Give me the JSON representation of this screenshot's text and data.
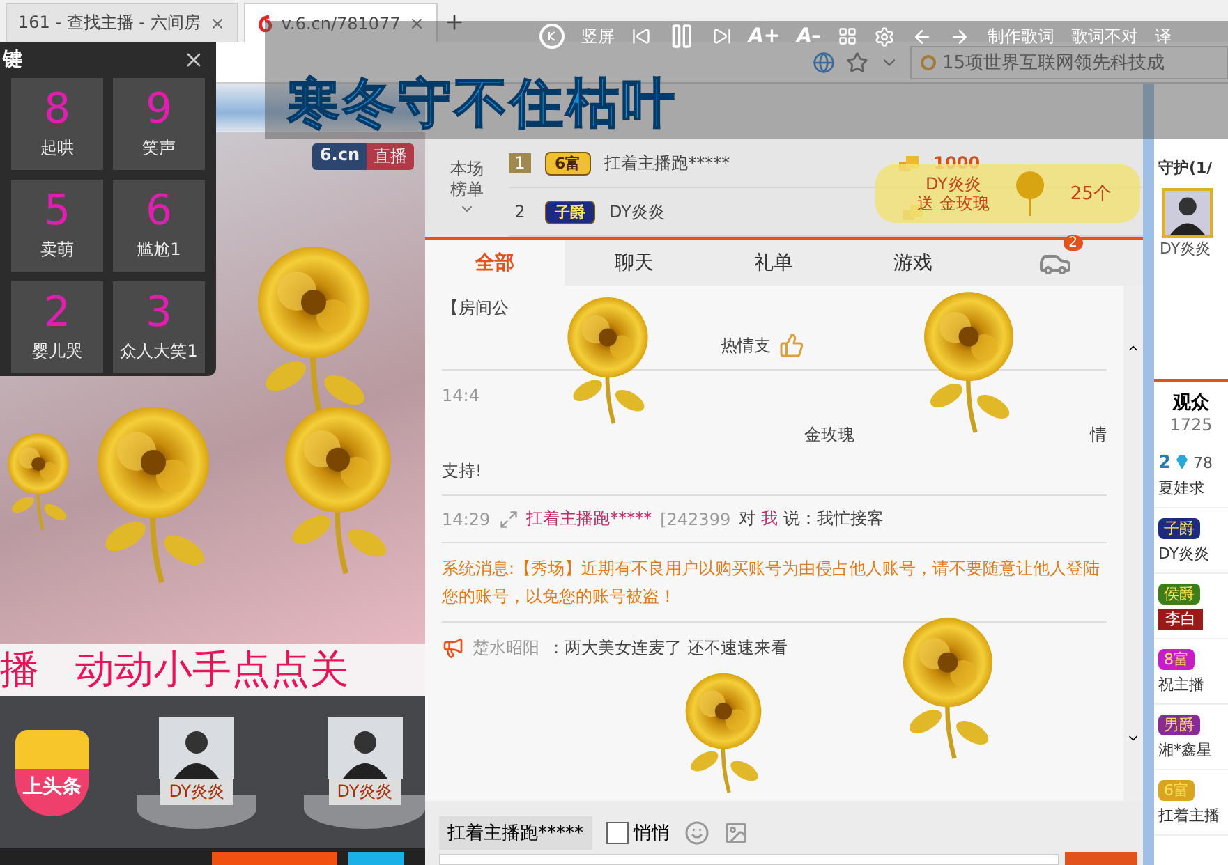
{
  "browser": {
    "tabs": [
      {
        "title": "161 - 查找主播 - 六间房",
        "selected": false
      },
      {
        "title": "v.6.cn/781077",
        "selected": true
      }
    ],
    "search_text": "15项世界互联网领先科技成"
  },
  "lyrics_window": {
    "toolbar": [
      {
        "kind": "logo"
      },
      {
        "kind": "text",
        "label": "竖屏"
      },
      {
        "kind": "prev"
      },
      {
        "kind": "pause"
      },
      {
        "kind": "next"
      },
      {
        "kind": "font",
        "label": "A+"
      },
      {
        "kind": "font",
        "label": "A–"
      },
      {
        "kind": "grid"
      },
      {
        "kind": "gear"
      },
      {
        "kind": "left"
      },
      {
        "kind": "right"
      },
      {
        "kind": "text",
        "label": "制作歌词"
      },
      {
        "kind": "text",
        "label": "歌词不对"
      },
      {
        "kind": "text",
        "label": "译"
      }
    ],
    "lyric": "寒冬守不住枯叶"
  },
  "sound_keys": {
    "title": "键",
    "keys": [
      {
        "key": "8",
        "label": "起哄"
      },
      {
        "key": "9",
        "label": "笑声"
      },
      {
        "key": "5",
        "label": "卖萌"
      },
      {
        "key": "6",
        "label": "尴尬1"
      },
      {
        "key": "2",
        "label": "婴儿哭"
      },
      {
        "key": "3",
        "label": "众人大笑1"
      }
    ]
  },
  "video": {
    "brand": "6.cn",
    "live": "直播",
    "ticker": [
      "播",
      "动动小手点点关"
    ]
  },
  "headline": {
    "label": "上头条"
  },
  "pedestals": [
    {
      "name": "DY炎炎"
    },
    {
      "name": "DY炎炎"
    }
  ],
  "ranking": {
    "title": "本场榜单",
    "rows": [
      {
        "rank": "1",
        "kind": "fortune",
        "badge": "6富",
        "name": "扛着主播跑*****",
        "score": "1000"
      },
      {
        "rank": "2",
        "kind": "noble",
        "badge": "子爵",
        "name": "DY炎炎"
      }
    ]
  },
  "gift_notice": {
    "sender": "DY炎炎",
    "action": "送 金玫瑰",
    "count": "25个"
  },
  "chat_tabs": [
    {
      "label": "全部",
      "selected": true
    },
    {
      "label": "聊天",
      "selected": false
    },
    {
      "label": "礼单",
      "selected": false
    },
    {
      "label": "游戏",
      "selected": false
    }
  ],
  "car_badge": "2",
  "chat": [
    {
      "kind": "notice",
      "text": "【房间公"
    },
    {
      "kind": "fragment",
      "text": "热情支"
    },
    {
      "kind": "gift",
      "time": "14:4",
      "item": "金玫瑰",
      "tail": "情",
      "more": "支持!"
    },
    {
      "kind": "private",
      "time": "14:29",
      "user": "扛着主播跑*****",
      "uid": "[242399",
      "prefix": "对",
      "target": "我",
      "suffix": "说：我忙接客"
    },
    {
      "kind": "system",
      "label": "系统消息:",
      "text": "【秀场】近期有不良用户以购买账号为由侵占他人账号，请不要随意让他人登陆您的账号，以免您的账号被盗！"
    },
    {
      "kind": "broadcast",
      "user": "楚水昭阳",
      "text": "：两大美女连麦了 还不速速来看"
    }
  ],
  "composer": {
    "target": "扛着主播跑*****",
    "whisper": {
      "label": "悄悄",
      "checked": false
    }
  },
  "guard": {
    "title": "守护(1/",
    "members": [
      {
        "name": "DY炎炎"
      }
    ]
  },
  "audience": {
    "title": "观众",
    "count": "1725",
    "members": [
      {
        "kind": "level",
        "badge": "2",
        "extra": "78",
        "name": "夏娃求"
      },
      {
        "kind": "title",
        "badge": "子爵",
        "color": "#1c2a80",
        "name": "DY炎炎"
      },
      {
        "kind": "tag",
        "badge": "侯爵",
        "color": "#3d7d1a",
        "name": "李白"
      },
      {
        "kind": "title",
        "badge": "8富",
        "color": "#c41fc4",
        "name": "祝主播"
      },
      {
        "kind": "title",
        "badge": "男爵",
        "color": "#8a2a9a",
        "name": "湘*鑫星"
      },
      {
        "kind": "title",
        "badge": "6富",
        "color": "#d9a521",
        "name": "扛着主播"
      }
    ]
  }
}
